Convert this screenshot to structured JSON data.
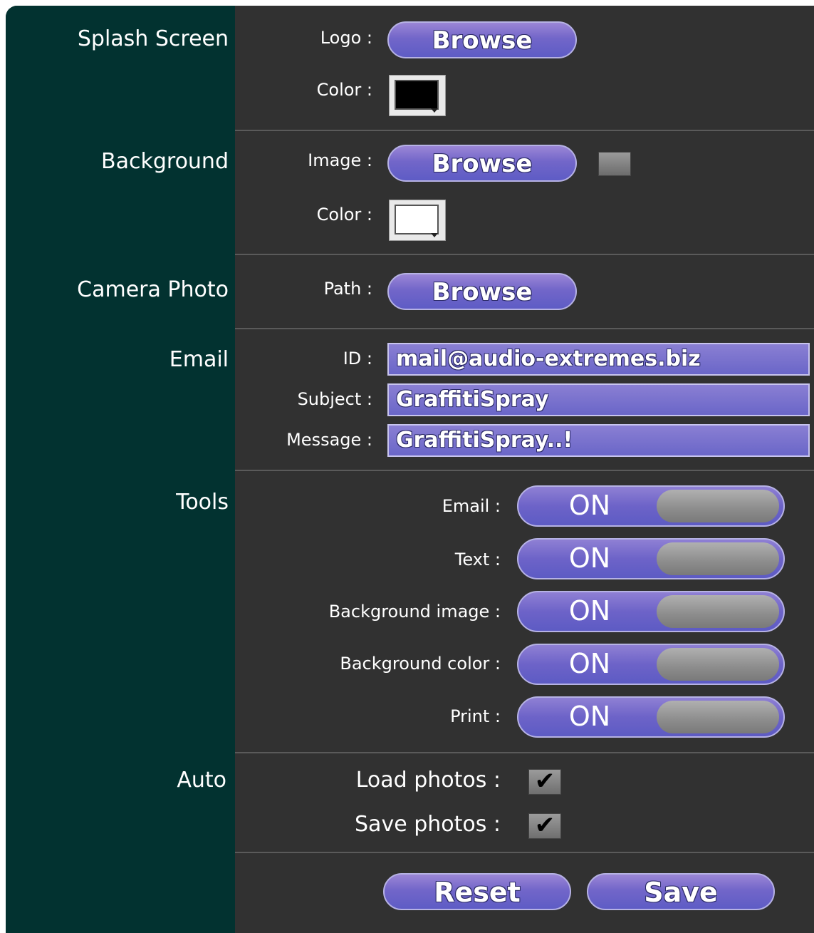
{
  "sections": {
    "splash": {
      "label": "Splash Screen",
      "logo_label": "Logo :",
      "logo_button": "Browse",
      "color_label": "Color :",
      "color_value": "#000000"
    },
    "background": {
      "label": "Background",
      "image_label": "Image :",
      "image_button": "Browse",
      "color_label": "Color :",
      "color_value": "#ffffff"
    },
    "camera": {
      "label": "Camera Photo",
      "path_label": "Path :",
      "path_button": "Browse"
    },
    "email": {
      "label": "Email",
      "id_label": "ID :",
      "id_value": "mail@audio-extremes.biz",
      "subject_label": "Subject :",
      "subject_value": "GraffitiSpray",
      "message_label": "Message :",
      "message_value": "GraffitiSpray..!"
    },
    "tools": {
      "label": "Tools",
      "items": [
        {
          "label": "Email :",
          "state": "ON"
        },
        {
          "label": "Text :",
          "state": "ON"
        },
        {
          "label": "Background image :",
          "state": "ON"
        },
        {
          "label": "Background color :",
          "state": "ON"
        },
        {
          "label": "Print :",
          "state": "ON"
        }
      ]
    },
    "auto": {
      "label": "Auto",
      "load_label": "Load photos :",
      "load_checked": "✔",
      "save_label": "Save photos :",
      "save_checked": "✔"
    }
  },
  "actions": {
    "reset_label": "Reset",
    "save_label": "Save"
  },
  "colors": {
    "panel": "#313131",
    "sidebar": "#023230",
    "accent": "#6d63c8"
  }
}
